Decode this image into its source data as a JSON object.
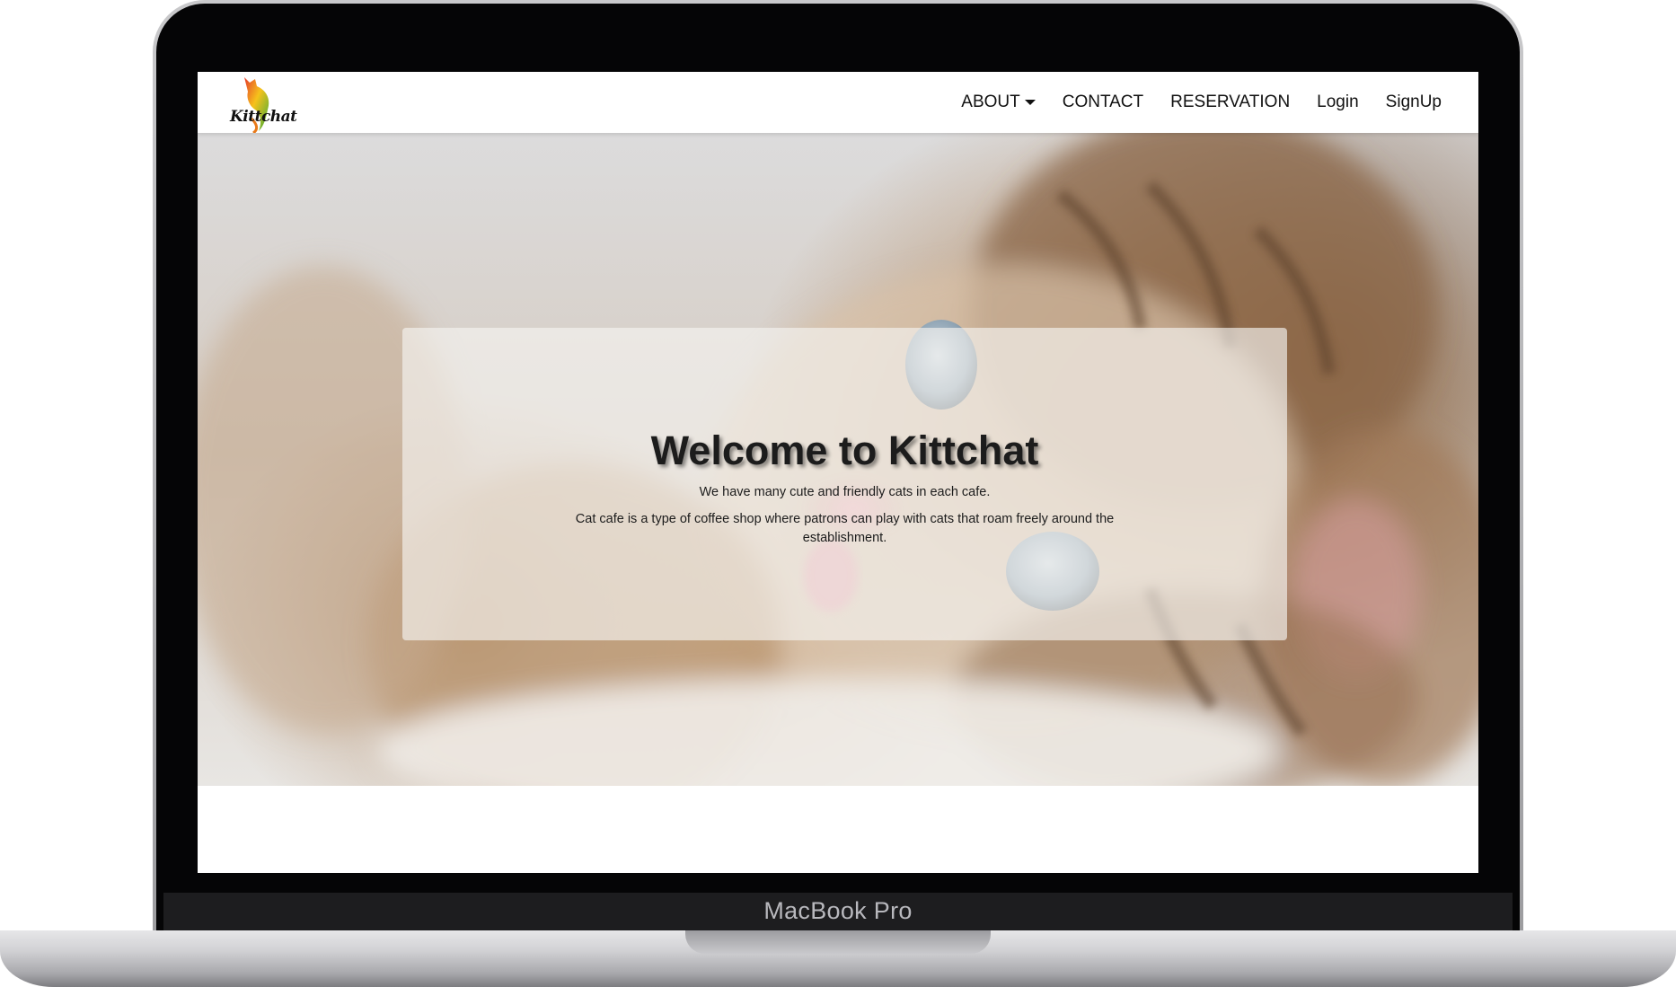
{
  "device": {
    "label": "MacBook Pro"
  },
  "site": {
    "logo_text": "Kittchat"
  },
  "nav": {
    "items": [
      {
        "label": "ABOUT",
        "has_dropdown": true
      },
      {
        "label": "CONTACT",
        "has_dropdown": false
      },
      {
        "label": "RESERVATION",
        "has_dropdown": false
      },
      {
        "label": "Login",
        "has_dropdown": false
      },
      {
        "label": "SignUp",
        "has_dropdown": false
      }
    ]
  },
  "hero": {
    "title": "Welcome to Kittchat",
    "tagline": "We have many cute and friendly cats in each cafe.",
    "description": "Cat cafe is a type of coffee shop where patrons can play with cats that roam freely around the establishment.",
    "background_image": "kitten-photo"
  },
  "colors": {
    "nav_text": "#111111",
    "title_text": "#1c1c1c",
    "bezel": "#050506",
    "chin": "#1d1d1f"
  }
}
